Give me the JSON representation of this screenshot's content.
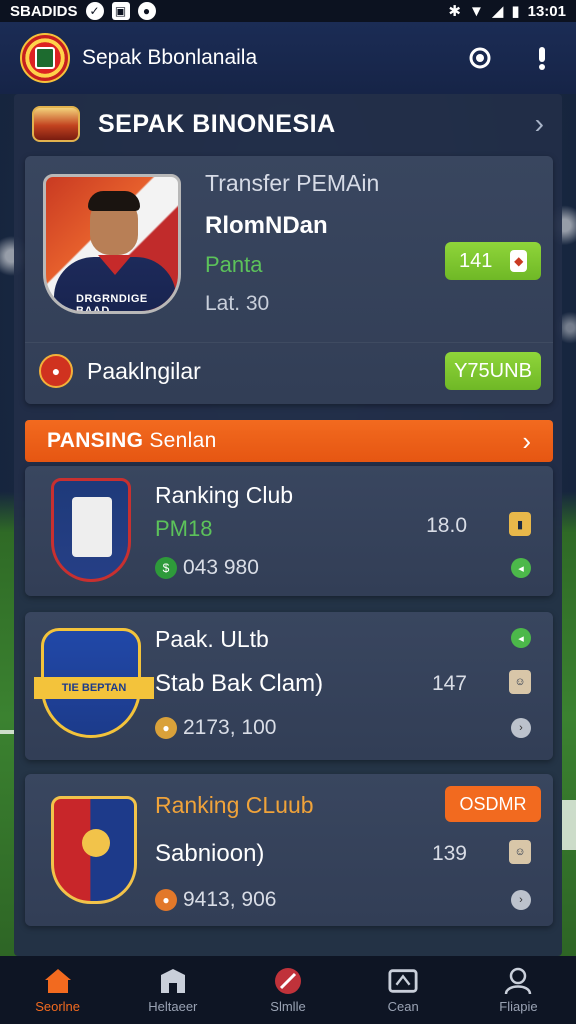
{
  "status_bar": {
    "left_text": "SBADIDS",
    "time": "13:01"
  },
  "app_bar": {
    "title": "Sepak Bbonlanaila"
  },
  "section": {
    "title": "SEPAK BINONESIA"
  },
  "transfer": {
    "label": "Transfer PEMAin",
    "player_name": "RlomNDan",
    "position": "Panta",
    "meta": "Lat. 30",
    "rating": "141",
    "fee_label": "Paaklngilar",
    "fee_value": "Y75UNB",
    "shirt_text": "DRGRNDIGE BAAD"
  },
  "orange_bar": {
    "title_bold": "PANSING",
    "title_rest": "Senlan"
  },
  "clubs": [
    {
      "title": "Ranking Club",
      "subtitle": "PM18",
      "subtitle_color": "#5cc25a",
      "count": "043 980",
      "number": "18.0"
    },
    {
      "title": "Paak. ULtb",
      "subtitle": "Stab Bak Clam)",
      "subtitle_color": "#ffffff",
      "count": "2173, 100",
      "number": "147",
      "crest_text": "TIE BEPTAN"
    },
    {
      "title": "Ranking CLuub",
      "subtitle": "Sabnioon)",
      "subtitle_color": "#ffffff",
      "count": "9413, 906",
      "number": "139",
      "badge": "OSDMR"
    }
  ],
  "nav": [
    {
      "label": "Seorlne",
      "icon": "home-icon",
      "active": true
    },
    {
      "label": "Heltaeer",
      "icon": "building-icon",
      "active": false
    },
    {
      "label": "Slmlle",
      "icon": "ball-icon",
      "active": false
    },
    {
      "label": "Cean",
      "icon": "card-icon",
      "active": false
    },
    {
      "label": "Fliapie",
      "icon": "profile-icon",
      "active": false
    }
  ],
  "colors": {
    "accent": "#f26a1f",
    "green": "#7ec52e",
    "panel": "#222e48",
    "card": "#36435b"
  }
}
